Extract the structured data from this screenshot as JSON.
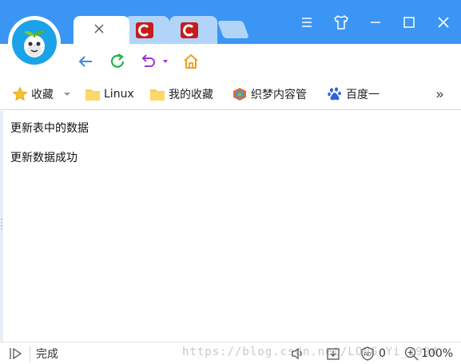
{
  "tabs": [
    {
      "label": "",
      "active": true,
      "close_icon": "close-icon"
    },
    {
      "label": "",
      "active": false,
      "icon": "c-site-icon"
    },
    {
      "label": "",
      "active": false,
      "icon": "c-site-icon"
    }
  ],
  "window_controls": [
    "menu-icon",
    "skin-icon",
    "minimize-icon",
    "maximize-icon",
    "close-icon"
  ],
  "bookmarks": {
    "favorites_label": "收藏",
    "items": [
      {
        "label": "Linux",
        "icon": "folder-icon"
      },
      {
        "label": "我的收藏",
        "icon": "folder-icon"
      },
      {
        "label": "织梦内容管",
        "icon": "dedecms-icon"
      },
      {
        "label": "百度一",
        "icon": "baidu-paw-icon"
      }
    ],
    "more_label": "»"
  },
  "content": {
    "lines": [
      "更新表中的数据",
      "更新数据成功"
    ]
  },
  "status": {
    "text": "完成",
    "watermark": "https://blog.csdn.net/LONG_Yi_1994",
    "ad_count": "0",
    "zoom": "100%"
  },
  "colors": {
    "titlebar": "#3b95f4",
    "tab_inactive": "#b2d4f9",
    "back_arrow": "#3b87e8",
    "refresh": "#22b14c",
    "undo": "#a233d8",
    "home": "#f0a020",
    "folder": "#f8cf5a"
  }
}
